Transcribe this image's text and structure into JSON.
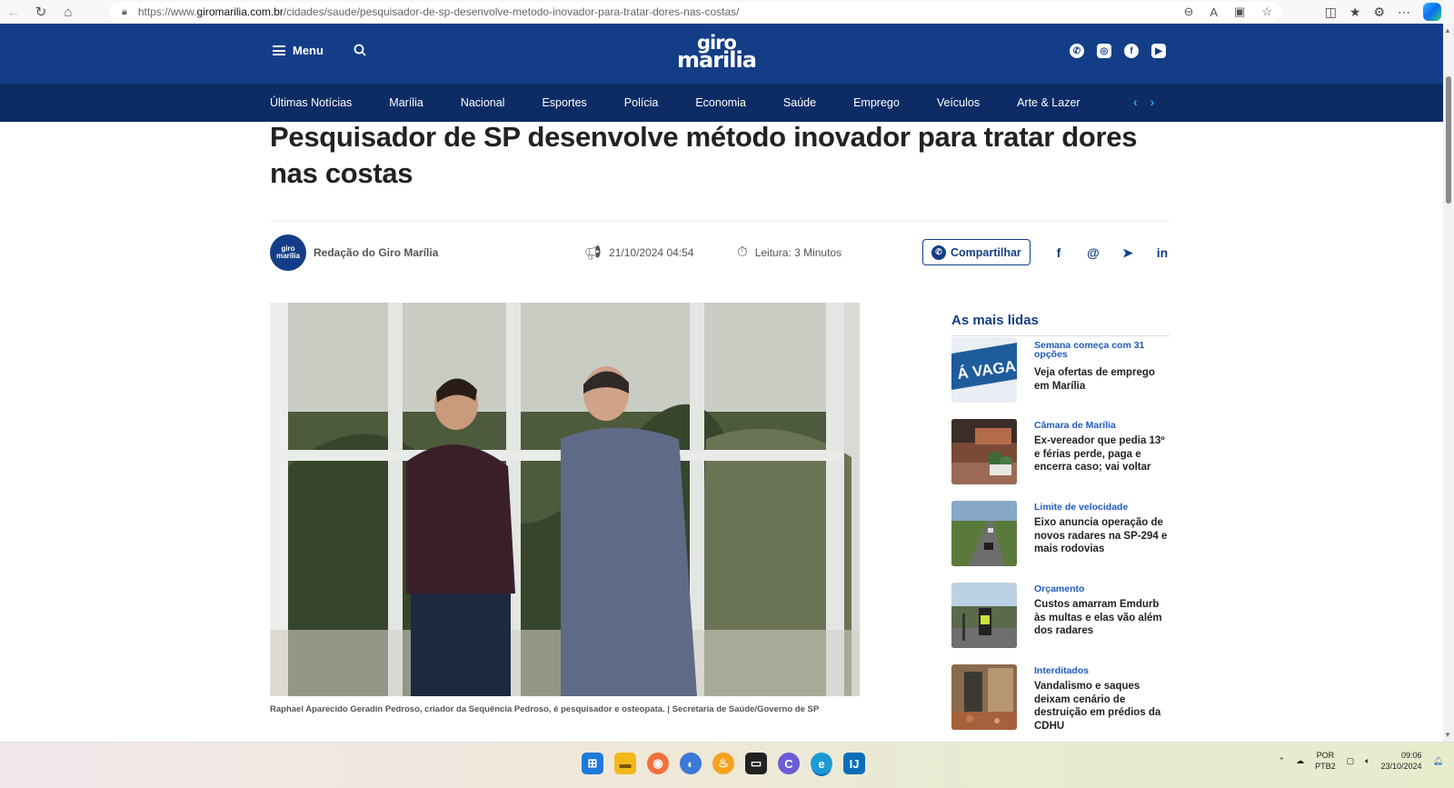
{
  "browser": {
    "url_prefix": "https://www.",
    "url_host": "giromarilia.com.br",
    "url_path": "/cidades/saude/pesquisador-de-sp-desenvolve-metodo-inovador-para-tratar-dores-nas-costas/"
  },
  "header": {
    "menu_label": "Menu",
    "logo_line1": "giro",
    "logo_line2": "marilia",
    "social_icons": [
      "whatsapp-icon",
      "instagram-icon",
      "facebook-icon",
      "youtube-icon"
    ]
  },
  "nav": {
    "items": [
      "Últimas Notícias",
      "Marília",
      "Nacional",
      "Esportes",
      "Polícia",
      "Economia",
      "Saúde",
      "Emprego",
      "Veículos",
      "Arte & Lazer"
    ]
  },
  "article": {
    "title": "Pesquisador de SP desenvolve método inovador para tratar dores nas costas",
    "author": "Redação do Giro Marília",
    "avatar_text": "giro marília",
    "date": "21/10/2024 04:54",
    "reading_time": "Leitura: 3 Minutos",
    "share_label": "Compartilhar",
    "caption": "Raphael Aparecido Geradin Pedroso, criador da Sequência Pedroso, é pesquisador e osteopata. | Secretaria de Saúde/Governo de SP"
  },
  "sidebar": {
    "title": "As mais lidas",
    "items": [
      {
        "tag": "Semana começa com 31 opções",
        "headline": "Veja ofertas de emprego em Marília",
        "thumb_text": "Á VAGA"
      },
      {
        "tag": "Câmara de Marília",
        "headline": "Ex-vereador que pedia 13º e férias perde, paga e encerra caso; vai voltar"
      },
      {
        "tag": "Limite de velocidade",
        "headline": "Eixo anuncia operação de novos radares na SP-294 e mais rodovias"
      },
      {
        "tag": "Orçamento",
        "headline": "Custos amarram Emdurb às multas e elas vão além dos radares"
      },
      {
        "tag": "Interditados",
        "headline": "Vandalismo e saques deixam cenário de destruição em prédios da CDHU"
      }
    ]
  },
  "taskbar": {
    "lang_line1": "POR",
    "lang_line2": "PTB2",
    "time": "09:06",
    "date": "23/10/2024"
  },
  "colors": {
    "brand_blue": "#133e87",
    "nav_dark": "#0d2c66",
    "tag_blue": "#1f5bbf"
  }
}
